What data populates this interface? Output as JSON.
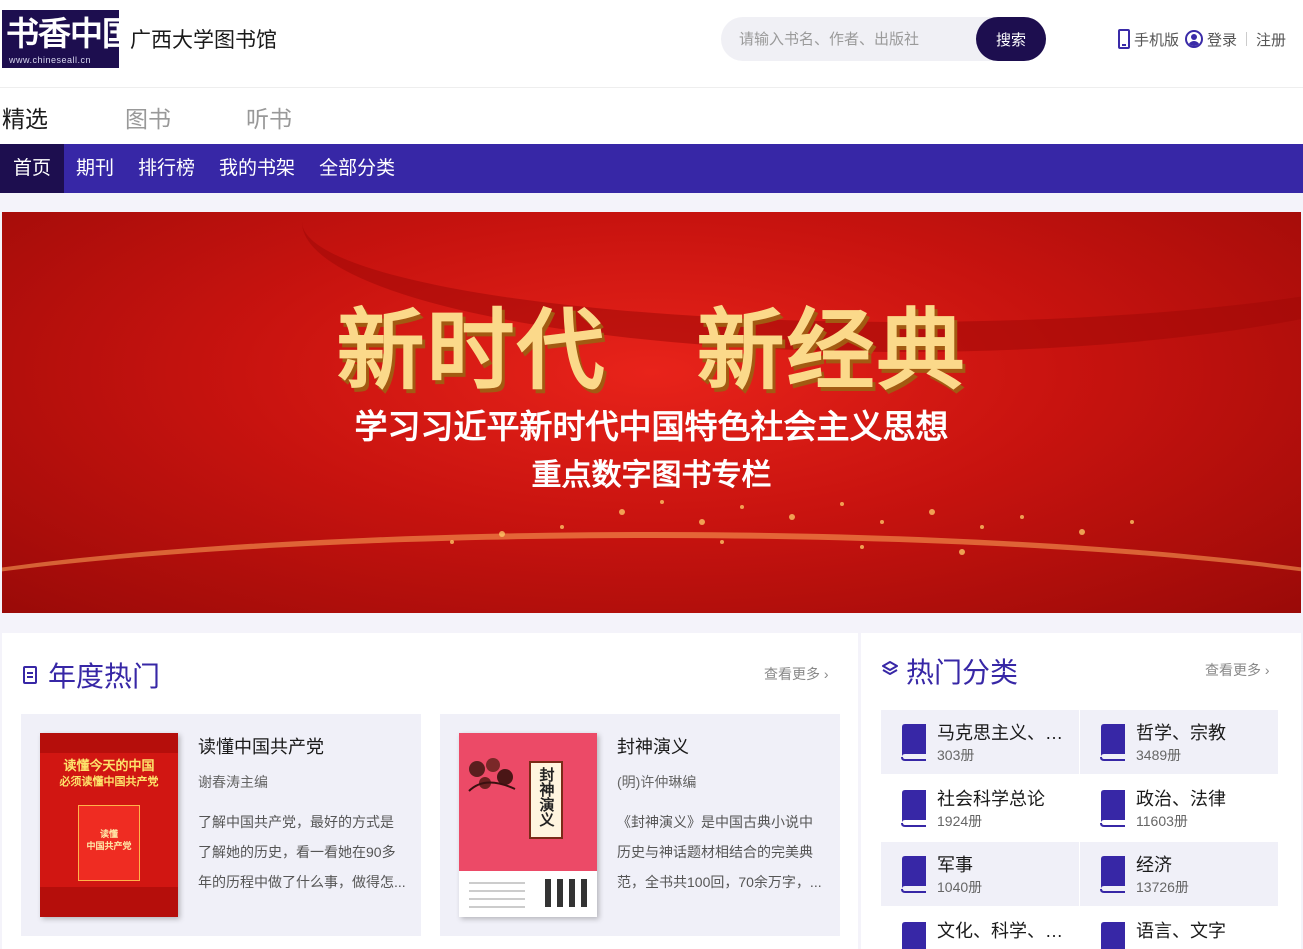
{
  "header": {
    "logo_text": "书香中国",
    "logo_url_text": "www.chineseall.cn",
    "library_name": "广西大学图书馆",
    "search_placeholder": "请输入书名、作者、出版社",
    "search_button": "搜索",
    "mobile_link": "手机版",
    "login_link": "登录",
    "register_link": "注册"
  },
  "section_tabs": [
    {
      "label": "精选",
      "active": true
    },
    {
      "label": "图书",
      "active": false
    },
    {
      "label": "听书",
      "active": false
    }
  ],
  "nav": [
    {
      "label": "首页",
      "active": true
    },
    {
      "label": "期刊",
      "active": false
    },
    {
      "label": "排行榜",
      "active": false
    },
    {
      "label": "我的书架",
      "active": false
    },
    {
      "label": "全部分类",
      "active": false
    }
  ],
  "banner": {
    "title": "新时代　新经典",
    "subtitle1": "学习习近平新时代中国特色社会主义思想",
    "subtitle2": "重点数字图书专栏"
  },
  "annual_hot": {
    "title": "年度热门",
    "more": "查看更多",
    "books": [
      {
        "title": "读懂中国共产党",
        "author": "谢春涛主编",
        "description": "了解中国共产党，最好的方式是了解她的历史，看一看她在90多年的历程中做了什么事，做得怎...",
        "cover_line1": "读懂今天的中国",
        "cover_line2": "必须读懂中国共产党",
        "cover_book_text": "读懂\n中国共产党"
      },
      {
        "title": "封神演义",
        "author": "(明)许仲琳编",
        "description": "《封神演义》是中国古典小说中历史与神话题材相结合的完美典范，全书共100回，70余万字，...",
        "cover_label": "封神演义"
      }
    ]
  },
  "hot_categories": {
    "title": "热门分类",
    "more": "查看更多",
    "items": [
      {
        "name": "马克思主义、…",
        "count": "303册"
      },
      {
        "name": "哲学、宗教",
        "count": "3489册"
      },
      {
        "name": "社会科学总论",
        "count": "1924册"
      },
      {
        "name": "政治、法律",
        "count": "11603册"
      },
      {
        "name": "军事",
        "count": "1040册"
      },
      {
        "name": "经济",
        "count": "13726册"
      },
      {
        "name": "文化、科学、…",
        "count": ""
      },
      {
        "name": "语言、文字",
        "count": ""
      }
    ]
  },
  "colors": {
    "brand_dark": "#1d0e4f",
    "nav_purple": "#3727a6",
    "banner_red": "#d11612"
  }
}
